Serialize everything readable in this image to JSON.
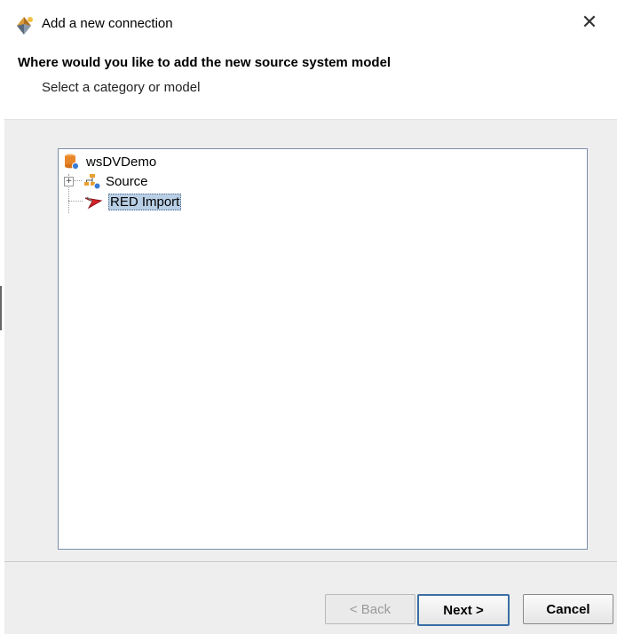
{
  "window": {
    "title": "Add a new connection",
    "app_icon": "wizard-icon",
    "close_label": "✕"
  },
  "header": {
    "title": "Where would you like to add the new source system model",
    "subtitle": "Select a category or model"
  },
  "tree": {
    "root": {
      "label": "wsDVDemo",
      "icon": "database-icon"
    },
    "children": [
      {
        "label": "Source",
        "icon": "network-icon",
        "expander": "+"
      },
      {
        "label": "RED Import",
        "icon": "red-import-icon",
        "selected": true
      }
    ]
  },
  "footer": {
    "back_label": "< Back",
    "next_label": "Next >",
    "cancel_label": "Cancel"
  },
  "colors": {
    "selection": "#b8cfe5",
    "primary_border": "#3a6ea5",
    "panel_bg": "#eeeeee"
  }
}
